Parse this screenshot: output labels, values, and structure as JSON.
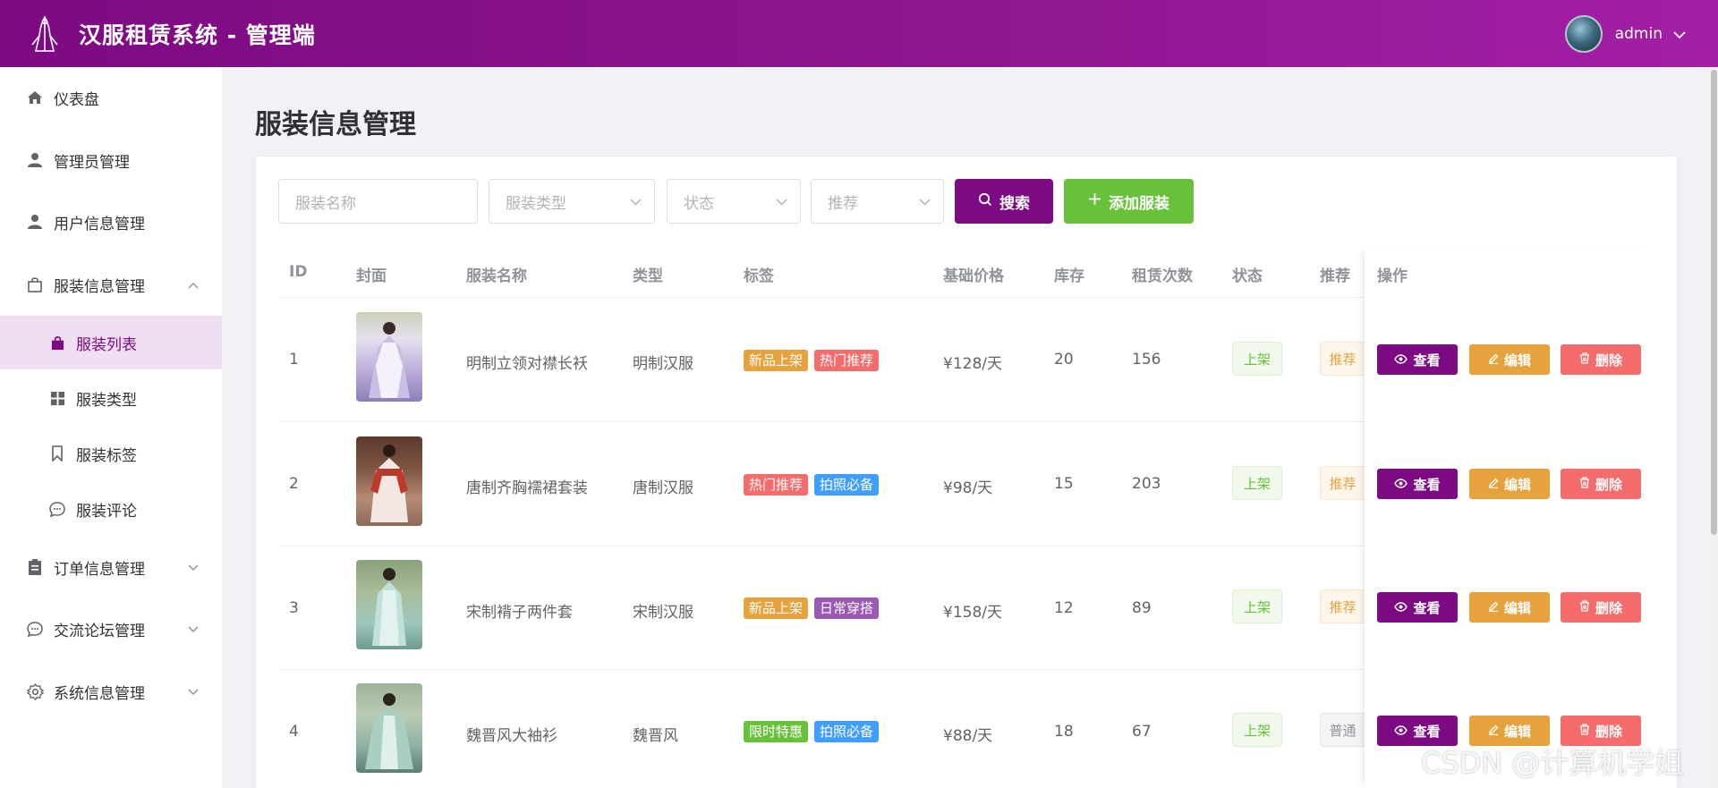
{
  "header": {
    "title": "汉服租赁系统 - 管理端",
    "username": "admin"
  },
  "sidebar": {
    "items": [
      {
        "label": "仪表盘",
        "icon": "home-icon"
      },
      {
        "label": "管理员管理",
        "icon": "user-icon"
      },
      {
        "label": "用户信息管理",
        "icon": "user-icon"
      },
      {
        "label": "服装信息管理",
        "icon": "bag-icon"
      },
      {
        "label": "订单信息管理",
        "icon": "clipboard-icon"
      },
      {
        "label": "交流论坛管理",
        "icon": "chat-icon"
      },
      {
        "label": "系统信息管理",
        "icon": "gear-icon"
      }
    ],
    "sub_items": [
      {
        "label": "服装列表",
        "icon": "bag-icon"
      },
      {
        "label": "服装类型",
        "icon": "grid-icon"
      },
      {
        "label": "服装标签",
        "icon": "bookmark-icon"
      },
      {
        "label": "服装评论",
        "icon": "chat-icon"
      }
    ]
  },
  "page": {
    "title": "服装信息管理"
  },
  "filters": {
    "name_placeholder": "服装名称",
    "type_placeholder": "服装类型",
    "status_placeholder": "状态",
    "recommend_placeholder": "推荐",
    "search_label": "搜索",
    "add_label": "添加服装"
  },
  "table": {
    "headers": {
      "id": "ID",
      "cover": "封面",
      "name": "服装名称",
      "type": "类型",
      "tags": "标签",
      "price": "基础价格",
      "stock": "库存",
      "rent_count": "租赁次数",
      "status": "状态",
      "recommend": "推荐",
      "actions": "操作"
    },
    "rows": [
      {
        "id": "1",
        "name": "明制立领对襟长袄",
        "type": "明制汉服",
        "tag1": "新品上架",
        "tag2": "热门推荐",
        "price": "¥128/天",
        "stock": "20",
        "rent_count": "156",
        "status": "上架",
        "recommend": "推荐"
      },
      {
        "id": "2",
        "name": "唐制齐胸襦裙套装",
        "type": "唐制汉服",
        "tag1": "热门推荐",
        "tag2": "拍照必备",
        "price": "¥98/天",
        "stock": "15",
        "rent_count": "203",
        "status": "上架",
        "recommend": "推荐"
      },
      {
        "id": "3",
        "name": "宋制褙子两件套",
        "type": "宋制汉服",
        "tag1": "新品上架",
        "tag2": "日常穿搭",
        "price": "¥158/天",
        "stock": "12",
        "rent_count": "89",
        "status": "上架",
        "recommend": "推荐"
      },
      {
        "id": "4",
        "name": "魏晋风大袖衫",
        "type": "魏晋风",
        "tag1": "限时特惠",
        "tag2": "拍照必备",
        "price": "¥88/天",
        "stock": "18",
        "rent_count": "67",
        "status": "上架",
        "recommend": "普通"
      }
    ],
    "actions": {
      "view": "查看",
      "edit": "编辑",
      "delete": "删除"
    }
  },
  "colors": {
    "brand": "#7c0a82",
    "new": "#e6a23c",
    "hot": "#f56c6c",
    "photo": "#409eff",
    "daily": "#9b59b6",
    "sale": "#67c23a"
  },
  "watermark": "CSDN @计算机学姐"
}
